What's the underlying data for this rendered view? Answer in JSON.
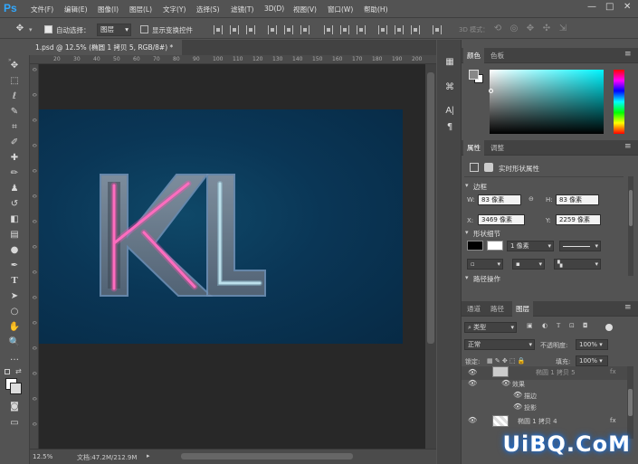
{
  "app": {
    "logo": "Ps"
  },
  "menu": [
    "文件(F)",
    "编辑(E)",
    "图像(I)",
    "图层(L)",
    "文字(Y)",
    "选择(S)",
    "滤镜(T)",
    "3D(D)",
    "视图(V)",
    "窗口(W)",
    "帮助(H)"
  ],
  "window": {
    "min": "—",
    "max": "□",
    "close": "✕"
  },
  "options": {
    "auto_select_label": "自动选择：",
    "auto_select_value": "图层",
    "show_transform": "显示变换控件",
    "mode_3d": "3D 模式："
  },
  "document": {
    "tab_title": "1.psd @ 12.5% (椭圆 1 拷贝 5, RGB/8#) *",
    "tab_close": "×",
    "canvas_text": "KL"
  },
  "ruler": {
    "top": [
      "20",
      "30",
      "40",
      "50",
      "60",
      "70",
      "80",
      "90",
      "100",
      "110",
      "120",
      "130",
      "140",
      "150",
      "160",
      "170",
      "180",
      "190",
      "200"
    ],
    "left": [
      "0",
      "0",
      "0",
      "0",
      "0",
      "0",
      "0",
      "0",
      "0",
      "0",
      "0",
      "0",
      "0",
      "0",
      "0"
    ]
  },
  "status": {
    "zoom": "12.5%",
    "doc_info": "文档:47.2M/212.9M"
  },
  "color_panel": {
    "tabs": [
      "颜色",
      "色板"
    ],
    "fg": "#888888",
    "bg": "#ffffff"
  },
  "properties": {
    "tabs": [
      "属性",
      "调整"
    ],
    "title": "实时形状属性",
    "section_bbox": "边框",
    "w_label": "W:",
    "w_value": "83 像素",
    "link": "⊖",
    "h_label": "H:",
    "h_value": "83 像素",
    "x_label": "X:",
    "x_value": "3469 像素",
    "y_label": "Y:",
    "y_value": "2259 像素",
    "section_shape": "形状细节",
    "stroke_width": "1 像素",
    "section_path": "路径操作"
  },
  "layers": {
    "tabs": [
      "通道",
      "路径",
      "图层"
    ],
    "filter": "类型",
    "blend": "正常",
    "opacity_label": "不透明度:",
    "opacity": "100%",
    "lock_label": "锁定:",
    "fill_label": "填充:",
    "fill": "100%",
    "rows": [
      {
        "name": "椭圆 1 拷贝 5",
        "fx": "fx"
      },
      {
        "name": "效果"
      },
      {
        "name": "描边"
      },
      {
        "name": "投影"
      },
      {
        "name": "椭圆 1 拷贝 4",
        "fx": "fx"
      }
    ]
  },
  "watermark": "UiBQ.CoM"
}
